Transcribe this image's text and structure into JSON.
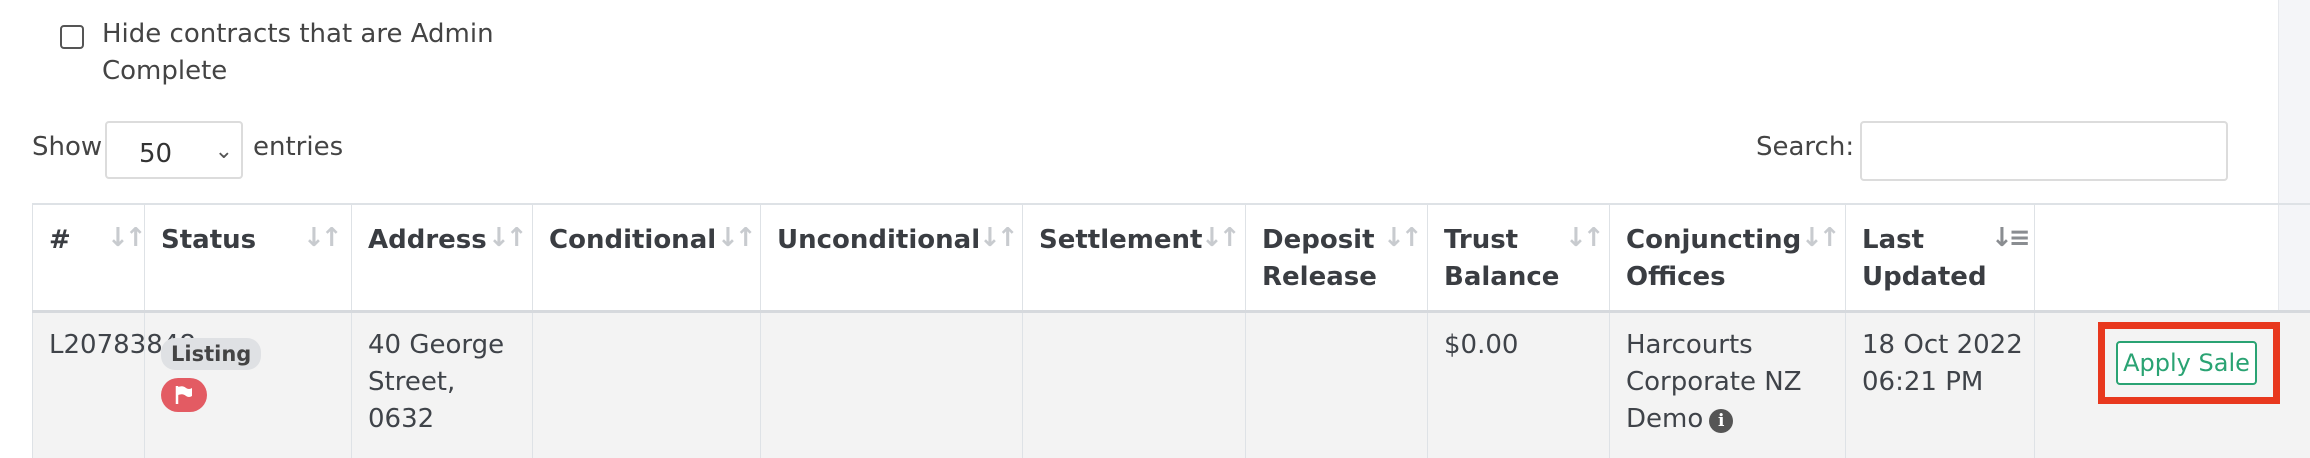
{
  "filter": {
    "label": "Hide contracts that are Admin Complete",
    "checked": false
  },
  "length": {
    "show_label": "Show",
    "selected": "50",
    "entries_label": "entries"
  },
  "search": {
    "label": "Search:",
    "value": ""
  },
  "columns": [
    {
      "label": "#"
    },
    {
      "label": "Status"
    },
    {
      "label": "Address"
    },
    {
      "label": "Conditional"
    },
    {
      "label": "Unconditional"
    },
    {
      "label": "Settlement"
    },
    {
      "label": "Deposit\nRelease"
    },
    {
      "label": "Trust\nBalance"
    },
    {
      "label": "Conjuncting\nOffices"
    },
    {
      "label": "Last\nUpdated",
      "sorted": "desc"
    },
    {
      "label": ""
    }
  ],
  "row": {
    "id": "L20783848",
    "status_badge": "Listing",
    "flag_icon": "flag-icon",
    "address": "40 George\nStreet,\n0632",
    "conditional": "",
    "unconditional": "",
    "settlement": "",
    "deposit_release": "",
    "trust_balance": "$0.00",
    "conjuncting_offices": "Harcourts\nCorporate NZ\nDemo",
    "info_icon": "i",
    "last_updated": "18 Oct 2022\n06:21 PM",
    "action_label": "Apply Sale"
  },
  "colors": {
    "action_green": "#2aa373",
    "highlight_red": "#e8381e",
    "flag_red": "#e35b63"
  }
}
